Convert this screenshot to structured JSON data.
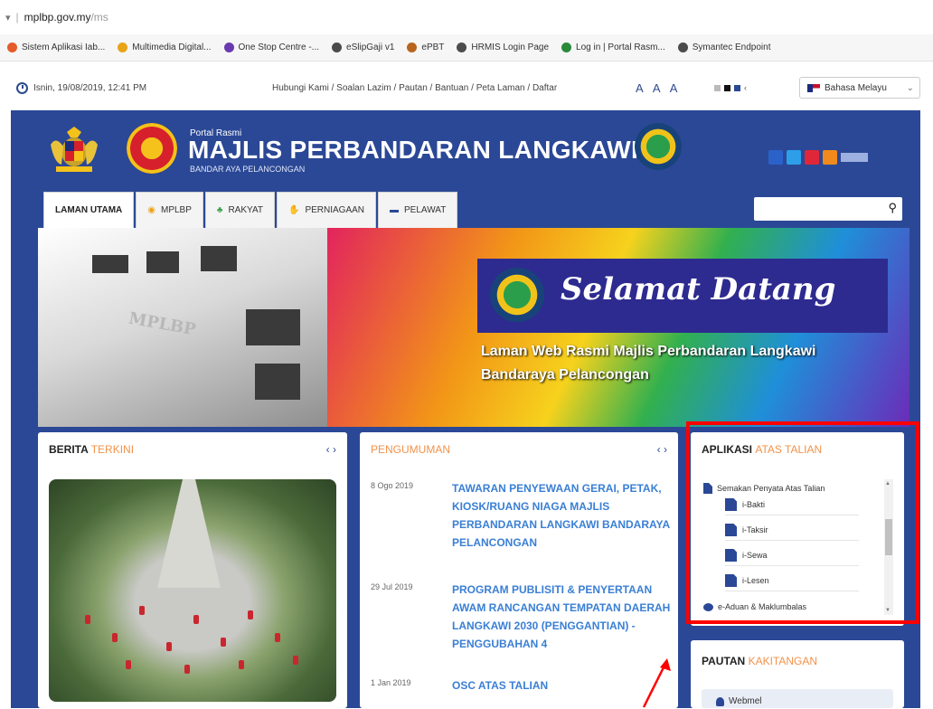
{
  "browser": {
    "url_main": "mplbp.gov.my",
    "url_rest": "/ms",
    "bookmarks": [
      {
        "label": "Sistem Aplikasi Iab...",
        "color": "#e45b2a"
      },
      {
        "label": "Multimedia Digital...",
        "color": "#e9a319"
      },
      {
        "label": "One Stop Centre -...",
        "color": "#6a3ab0"
      },
      {
        "label": "eSlipGaji v1",
        "color": "#4b4b4b"
      },
      {
        "label": "ePBT",
        "color": "#b8641d"
      },
      {
        "label": "HRMIS Login Page",
        "color": "#4b4b4b"
      },
      {
        "label": "Log in | Portal Rasm...",
        "color": "#2b8a3a"
      },
      {
        "label": "Symantec Endpoint",
        "color": "#4b4b4b"
      }
    ]
  },
  "utility": {
    "datetime": "Isnin, 19/08/2019, 12:41 PM",
    "links": "Hubungi Kami / Soalan Lazim / Pautan / Bantuan / Peta Laman / Daftar",
    "font_sizes": "A A A",
    "language": "Bahasa Melayu"
  },
  "header": {
    "portal_label": "Portal Rasmi",
    "title": "MAJLIS PERBANDARAN LANGKAWI",
    "tagline": "BANDAR AYA PELANCONGAN"
  },
  "nav": {
    "tabs": [
      {
        "label": "LAMAN UTAMA",
        "icon": "none"
      },
      {
        "label": "MPLBP",
        "icon": "building-icon"
      },
      {
        "label": "RAKYAT",
        "icon": "people-icon"
      },
      {
        "label": "PERNIAGAAN",
        "icon": "handshake-icon"
      },
      {
        "label": "PELAWAT",
        "icon": "id-card-icon"
      }
    ],
    "search_placeholder": ""
  },
  "banner": {
    "building_sign": "MPLBP",
    "welcome": "Selamat Datang",
    "line1": "Laman Web Rasmi Majlis Perbandaran Langkawi",
    "line2": "Bandaraya Pelancongan"
  },
  "berita": {
    "title_a": "BERITA",
    "title_b": "TERKINI",
    "arrows": "‹ ›"
  },
  "pengumuman": {
    "title": "PENGUMUMAN",
    "arrows": "‹ ›",
    "items": [
      {
        "date": "8 Ogo 2019",
        "headline": "TAWARAN PENYEWAAN GERAI, PETAK, KIOSK/RUANG NIAGA MAJLIS PERBANDARAN LANGKAWI BANDARAYA PELANCONGAN"
      },
      {
        "date": "29 Jul 2019",
        "headline": "PROGRAM PUBLISITI & PENYERTAAN AWAM RANCANGAN TEMPATAN DAERAH LANGKAWI 2030 (PENGGANTIAN) - PENGGUBAHAN 4"
      },
      {
        "date": "1 Jan 2019",
        "headline": "OSC ATAS TALIAN"
      }
    ]
  },
  "aplikasi": {
    "title_a": "APLIKASI",
    "title_b": "ATAS TALIAN",
    "parent": "Semakan Penyata Atas Talian",
    "children": [
      "i-Bakti",
      "i-Taksir",
      "i-Sewa",
      "i-Lesen"
    ],
    "aduan": "e-Aduan & Maklumbalas"
  },
  "pautan": {
    "title_a": "PAUTAN",
    "title_b": "KAKITANGAN",
    "item": "Webmel"
  },
  "colors": {
    "site_blue": "#2b4896",
    "accent_orange": "#f2924a",
    "link_blue": "#3a7fd5",
    "annotation_red": "#ff0000"
  }
}
